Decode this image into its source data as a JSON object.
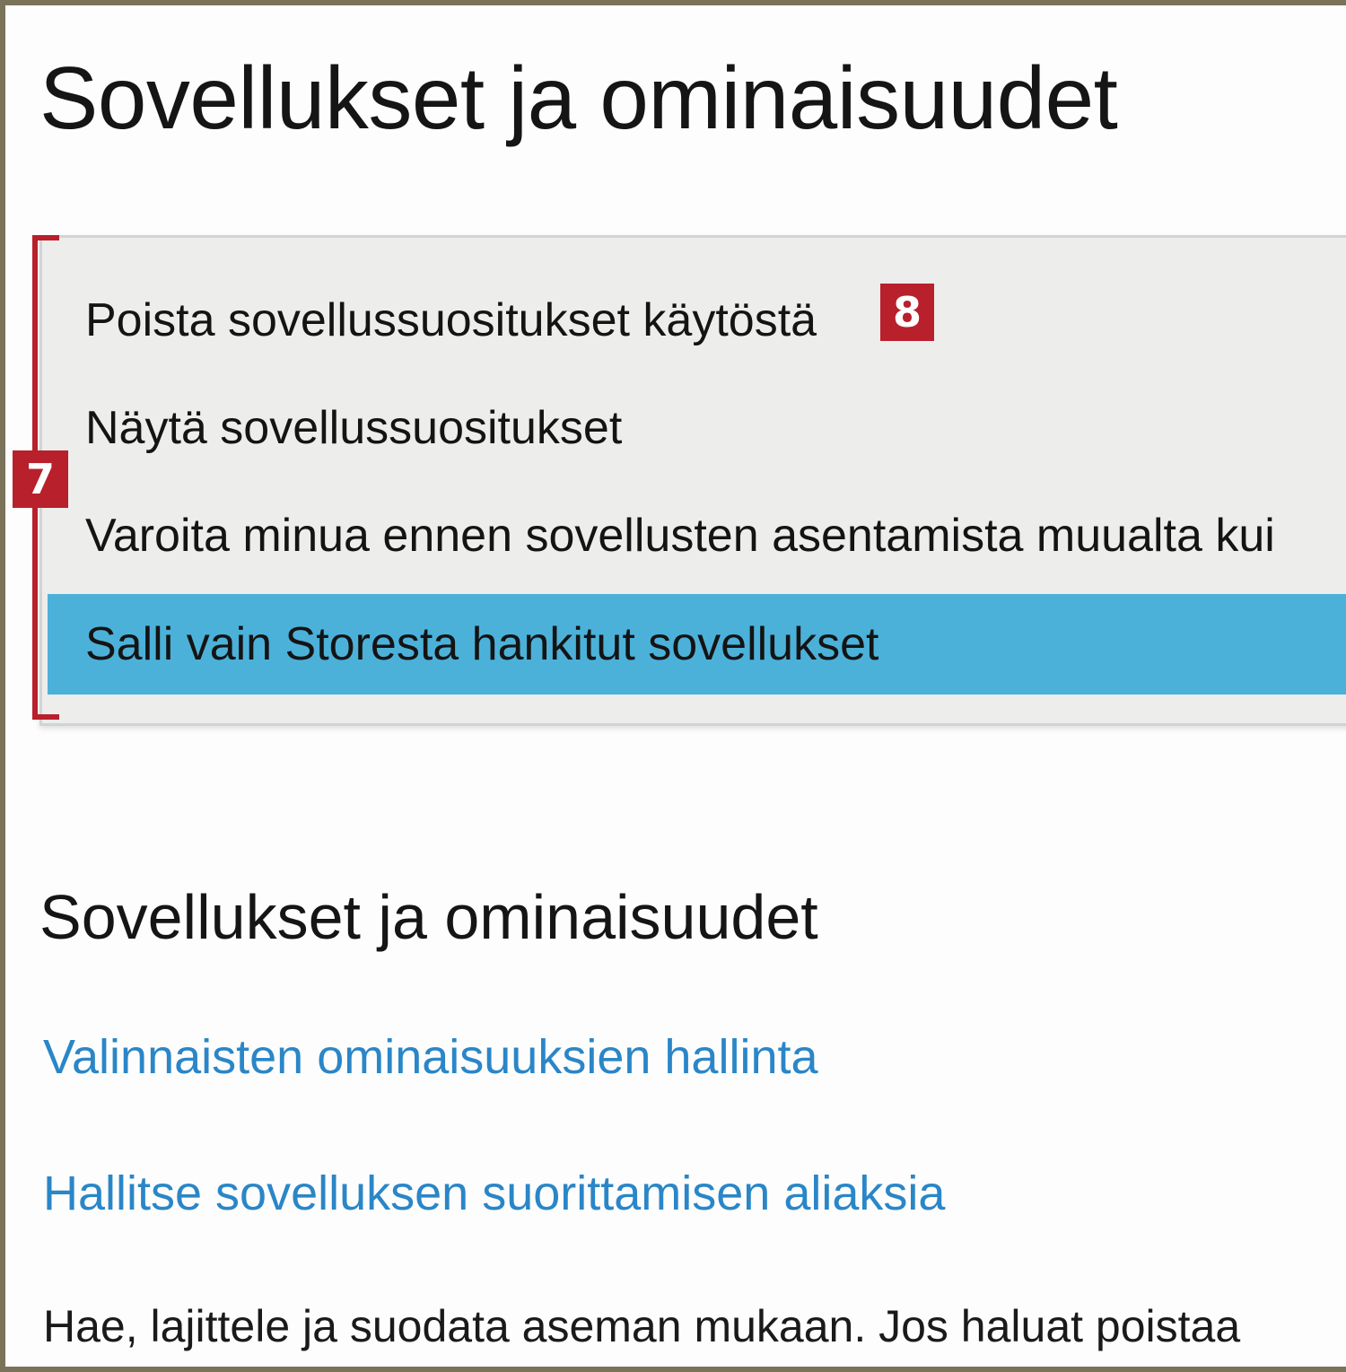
{
  "header": {
    "title": "Sovellukset ja ominaisuudet"
  },
  "install_source": {
    "options": [
      {
        "label": "Poista sovellussuositukset käytöstä",
        "selected": false
      },
      {
        "label": "Näytä sovellussuositukset",
        "selected": false
      },
      {
        "label": "Varoita minua ennen sovellusten asentamista muualta kui",
        "selected": false
      },
      {
        "label": "Salli vain Storesta hankitut sovellukset",
        "selected": true
      }
    ],
    "selected_color": "#4cb1d9"
  },
  "annotations": {
    "marker_dropdown": "7",
    "marker_option": "8",
    "color": "#b8202c"
  },
  "apps_section": {
    "heading": "Sovellukset ja ominaisuudet",
    "links": [
      "Valinnaisten ominaisuuksien hallinta",
      "Hallitse sovelluksen suorittamisen aliaksia"
    ],
    "description": "Hae, lajittele ja suodata aseman mukaan. Jos haluat poistaa"
  }
}
